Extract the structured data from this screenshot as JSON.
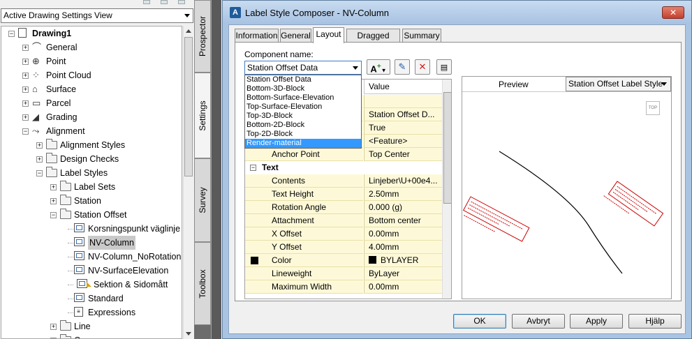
{
  "toolspace": {
    "view_selector": "Active Drawing Settings View",
    "tree": [
      {
        "label": "Drawing1",
        "bold": true,
        "icon": "drawing-icon",
        "level": 0,
        "toggle": "−"
      },
      {
        "label": "General",
        "icon": "general-icon",
        "level": 1,
        "toggle": "+"
      },
      {
        "label": "Point",
        "icon": "point-icon",
        "level": 1,
        "toggle": "+"
      },
      {
        "label": "Point Cloud",
        "icon": "point-cloud-icon",
        "level": 1,
        "toggle": "+"
      },
      {
        "label": "Surface",
        "icon": "surface-icon",
        "level": 1,
        "toggle": "+"
      },
      {
        "label": "Parcel",
        "icon": "parcel-icon",
        "level": 1,
        "toggle": "+"
      },
      {
        "label": "Grading",
        "icon": "grading-icon",
        "level": 1,
        "toggle": "+"
      },
      {
        "label": "Alignment",
        "icon": "alignment-icon",
        "level": 1,
        "toggle": "−"
      },
      {
        "label": "Alignment Styles",
        "icon": "folder-icon",
        "level": 2,
        "toggle": "+"
      },
      {
        "label": "Design Checks",
        "icon": "folder-icon",
        "level": 2,
        "toggle": "+"
      },
      {
        "label": "Label Styles",
        "icon": "folder-icon",
        "level": 2,
        "toggle": "−"
      },
      {
        "label": "Label Sets",
        "icon": "folder-icon",
        "level": 3,
        "toggle": "+"
      },
      {
        "label": "Station",
        "icon": "folder-icon",
        "level": 3,
        "toggle": "+"
      },
      {
        "label": "Station Offset",
        "icon": "folder-icon",
        "level": 3,
        "toggle": "−"
      },
      {
        "label": "Korsningspunkt väglinje",
        "icon": "label-style-icon",
        "level": 4,
        "toggle": ""
      },
      {
        "label": "NV-Column",
        "icon": "label-style-icon",
        "level": 4,
        "toggle": "",
        "selected": true
      },
      {
        "label": "NV-Column_NoRotation",
        "icon": "label-style-icon",
        "level": 4,
        "toggle": ""
      },
      {
        "label": "NV-SurfaceElevation",
        "icon": "label-style-icon",
        "level": 4,
        "toggle": ""
      },
      {
        "label": "Sektion & Sidomått",
        "icon": "label-style-icon",
        "level": 4,
        "toggle": "",
        "indent_extra": true
      },
      {
        "label": "Standard",
        "icon": "label-style-icon",
        "level": 4,
        "toggle": ""
      },
      {
        "label": "Expressions",
        "icon": "expressions-icon",
        "level": 4,
        "toggle": ""
      },
      {
        "label": "Line",
        "icon": "folder-icon",
        "level": 3,
        "toggle": "+"
      },
      {
        "label": "Curve",
        "icon": "folder-icon",
        "level": 3,
        "toggle": "+"
      }
    ],
    "side_tabs": [
      "Prospector",
      "Settings",
      "Survey",
      "Toolbox"
    ],
    "active_side_tab": "Settings"
  },
  "dialog": {
    "title": "Label Style Composer - NV-Column",
    "close_label": "✕",
    "tabs": [
      "Information",
      "General",
      "Layout",
      "Dragged State",
      "Summary"
    ],
    "active_tab": "Layout",
    "component_name_label": "Component name:",
    "component_selected": "Station Offset Data",
    "component_options": [
      "Station Offset Data",
      "Bottom-3D-Block",
      "Bottom-Surface-Elevation",
      "Top-Surface-Elevation",
      "Top-3D-Block",
      "Bottom-2D-Block",
      "Top-2D-Block",
      "Render-material"
    ],
    "highlighted_option": "Render-material",
    "grid": {
      "col_value": "Value",
      "rows": [
        {
          "prop": "",
          "value": "",
          "type": "blank"
        },
        {
          "prop": "",
          "value": "Station Offset D...",
          "type": "row"
        },
        {
          "prop": "",
          "value": "True",
          "type": "row"
        },
        {
          "prop": "",
          "value": "<Feature>",
          "type": "row"
        },
        {
          "prop": "Anchor Point",
          "value": "Top Center",
          "type": "row"
        },
        {
          "prop": "Text",
          "value": "",
          "type": "cat"
        },
        {
          "prop": "Contents",
          "value": "Linjeber\\U+00e4...",
          "type": "row"
        },
        {
          "prop": "Text Height",
          "value": "2.50mm",
          "type": "row"
        },
        {
          "prop": "Rotation Angle",
          "value": "0.000 (g)",
          "type": "row"
        },
        {
          "prop": "Attachment",
          "value": "Bottom center",
          "type": "row"
        },
        {
          "prop": "X Offset",
          "value": "0.00mm",
          "type": "row"
        },
        {
          "prop": "Y Offset",
          "value": "4.00mm",
          "type": "row"
        },
        {
          "prop": "Color",
          "value": "BYLAYER",
          "type": "color"
        },
        {
          "prop": "Lineweight",
          "value": "ByLayer",
          "type": "row"
        },
        {
          "prop": "Maximum Width",
          "value": "0.00mm",
          "type": "row"
        }
      ]
    },
    "preview": {
      "label": "Preview",
      "style_selected": "Station Offset Label Style",
      "top_badge": "TOP"
    },
    "buttons": {
      "ok": "OK",
      "cancel": "Avbryt",
      "apply": "Apply",
      "help": "Hjälp"
    }
  }
}
